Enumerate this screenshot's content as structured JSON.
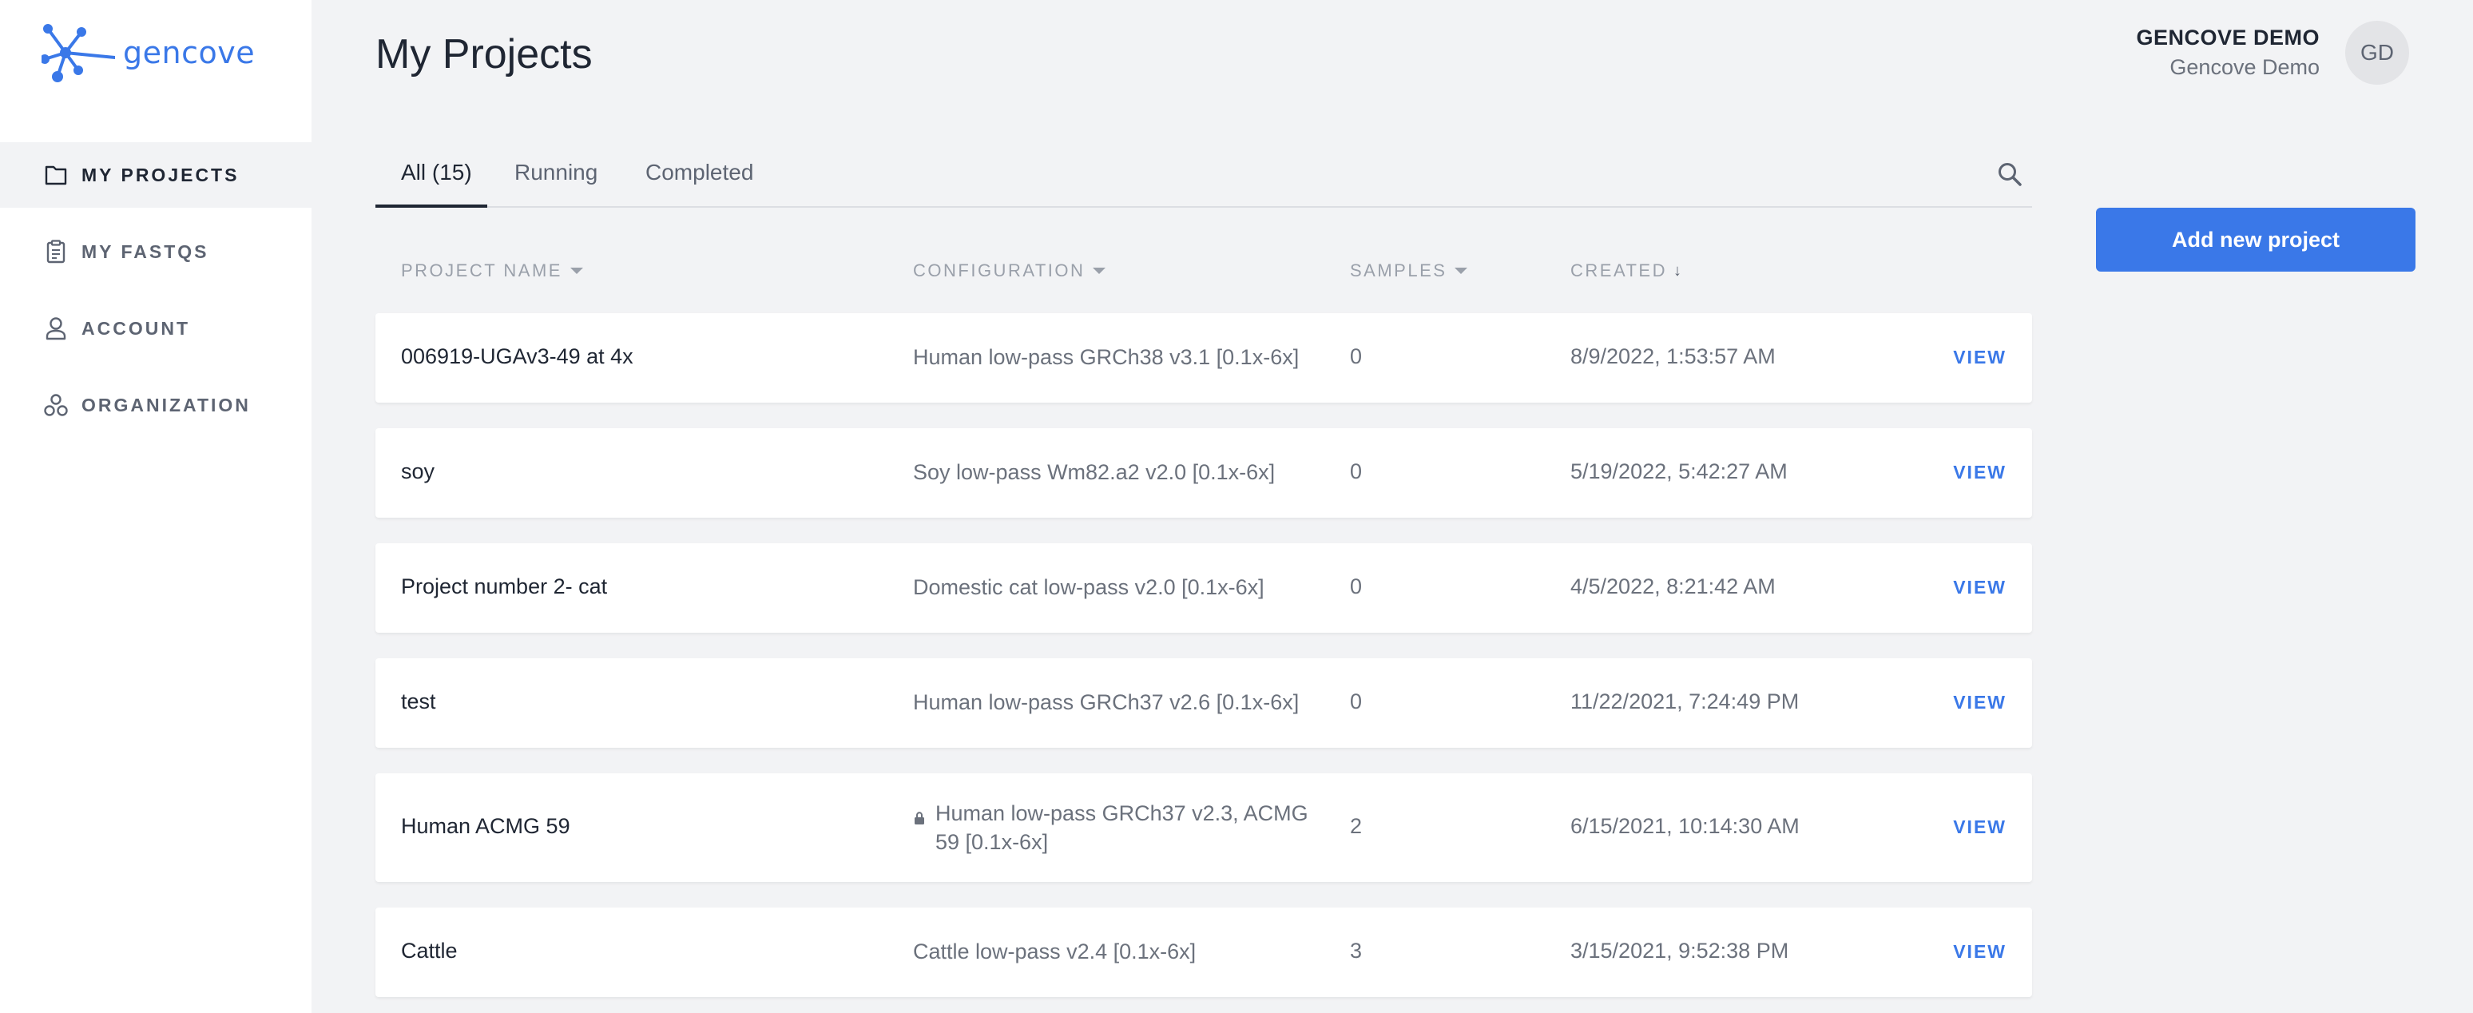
{
  "brand": {
    "name": "gencove",
    "accent_color": "#3a78e8"
  },
  "sidebar": {
    "items": [
      {
        "label": "MY PROJECTS",
        "icon": "folder-icon",
        "active": true
      },
      {
        "label": "MY FASTQS",
        "icon": "clipboard-icon",
        "active": false
      },
      {
        "label": "ACCOUNT",
        "icon": "user-icon",
        "active": false
      },
      {
        "label": "ORGANIZATION",
        "icon": "organization-icon",
        "active": false
      }
    ]
  },
  "header": {
    "title": "My Projects"
  },
  "user": {
    "name": "GENCOVE DEMO",
    "org": "Gencove Demo",
    "initials": "GD"
  },
  "tabs": [
    {
      "label": "All (15)",
      "active": true
    },
    {
      "label": "Running",
      "active": false
    },
    {
      "label": "Completed",
      "active": false
    }
  ],
  "actions": {
    "add_project": "Add new project"
  },
  "table": {
    "columns": {
      "name": "PROJECT NAME",
      "configuration": "CONFIGURATION",
      "samples": "SAMPLES",
      "created": "CREATED"
    },
    "view_label": "VIEW",
    "rows": [
      {
        "name": "006919-UGAv3-49 at 4x",
        "configuration": "Human low-pass GRCh38 v3.1 [0.1x-6x]",
        "samples": "0",
        "created": "8/9/2022, 1:53:57 AM",
        "locked": false
      },
      {
        "name": "soy",
        "configuration": "Soy low-pass Wm82.a2 v2.0 [0.1x-6x]",
        "samples": "0",
        "created": "5/19/2022, 5:42:27 AM",
        "locked": false
      },
      {
        "name": "Project number 2- cat",
        "configuration": "Domestic cat low-pass v2.0 [0.1x-6x]",
        "samples": "0",
        "created": "4/5/2022, 8:21:42 AM",
        "locked": false
      },
      {
        "name": "test",
        "configuration": "Human low-pass GRCh37 v2.6 [0.1x-6x]",
        "samples": "0",
        "created": "11/22/2021, 7:24:49 PM",
        "locked": false
      },
      {
        "name": "Human ACMG 59",
        "configuration": "Human low-pass GRCh37 v2.3, ACMG 59 [0.1x-6x]",
        "samples": "2",
        "created": "6/15/2021, 10:14:30 AM",
        "locked": true
      },
      {
        "name": "Cattle",
        "configuration": "Cattle low-pass v2.4 [0.1x-6x]",
        "samples": "3",
        "created": "3/15/2021, 9:52:38 PM",
        "locked": false
      }
    ]
  }
}
